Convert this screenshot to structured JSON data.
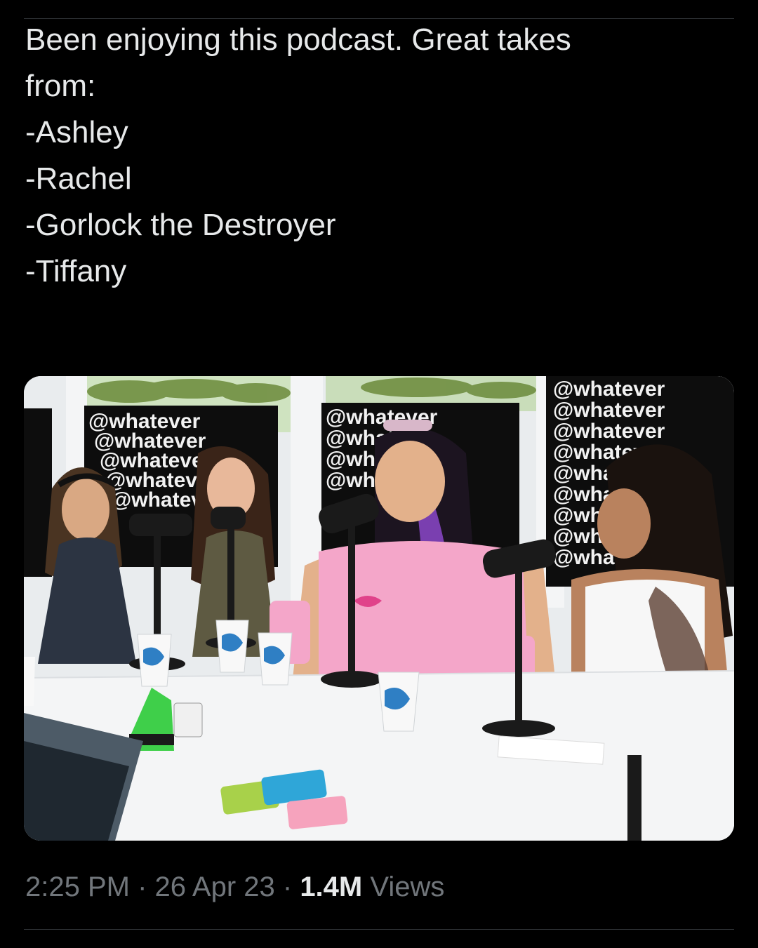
{
  "tweet": {
    "lines": [
      "Been enjoying this podcast. Great takes",
      "from:",
      "",
      "-Ashley",
      "-Rachel",
      "-Gorlock the Destroyer",
      "-Tiffany"
    ]
  },
  "media": {
    "backdrop_text": "@whatever",
    "cup_text": "",
    "colors": {
      "backdrop": "#0d0d0d",
      "wall": "#e9ecee",
      "table": "#f4f5f6",
      "pink_top": "#f4a6c9",
      "white_top": "#f7f7f7"
    }
  },
  "meta": {
    "time": "2:25 PM",
    "separator": " · ",
    "date": "26 Apr 23",
    "views_count": "1.4M",
    "views_label": "Views"
  },
  "colors": {
    "background": "#000000",
    "text": "#e7e9ea",
    "secondary_text": "#71767b",
    "divider": "#2f3336"
  }
}
